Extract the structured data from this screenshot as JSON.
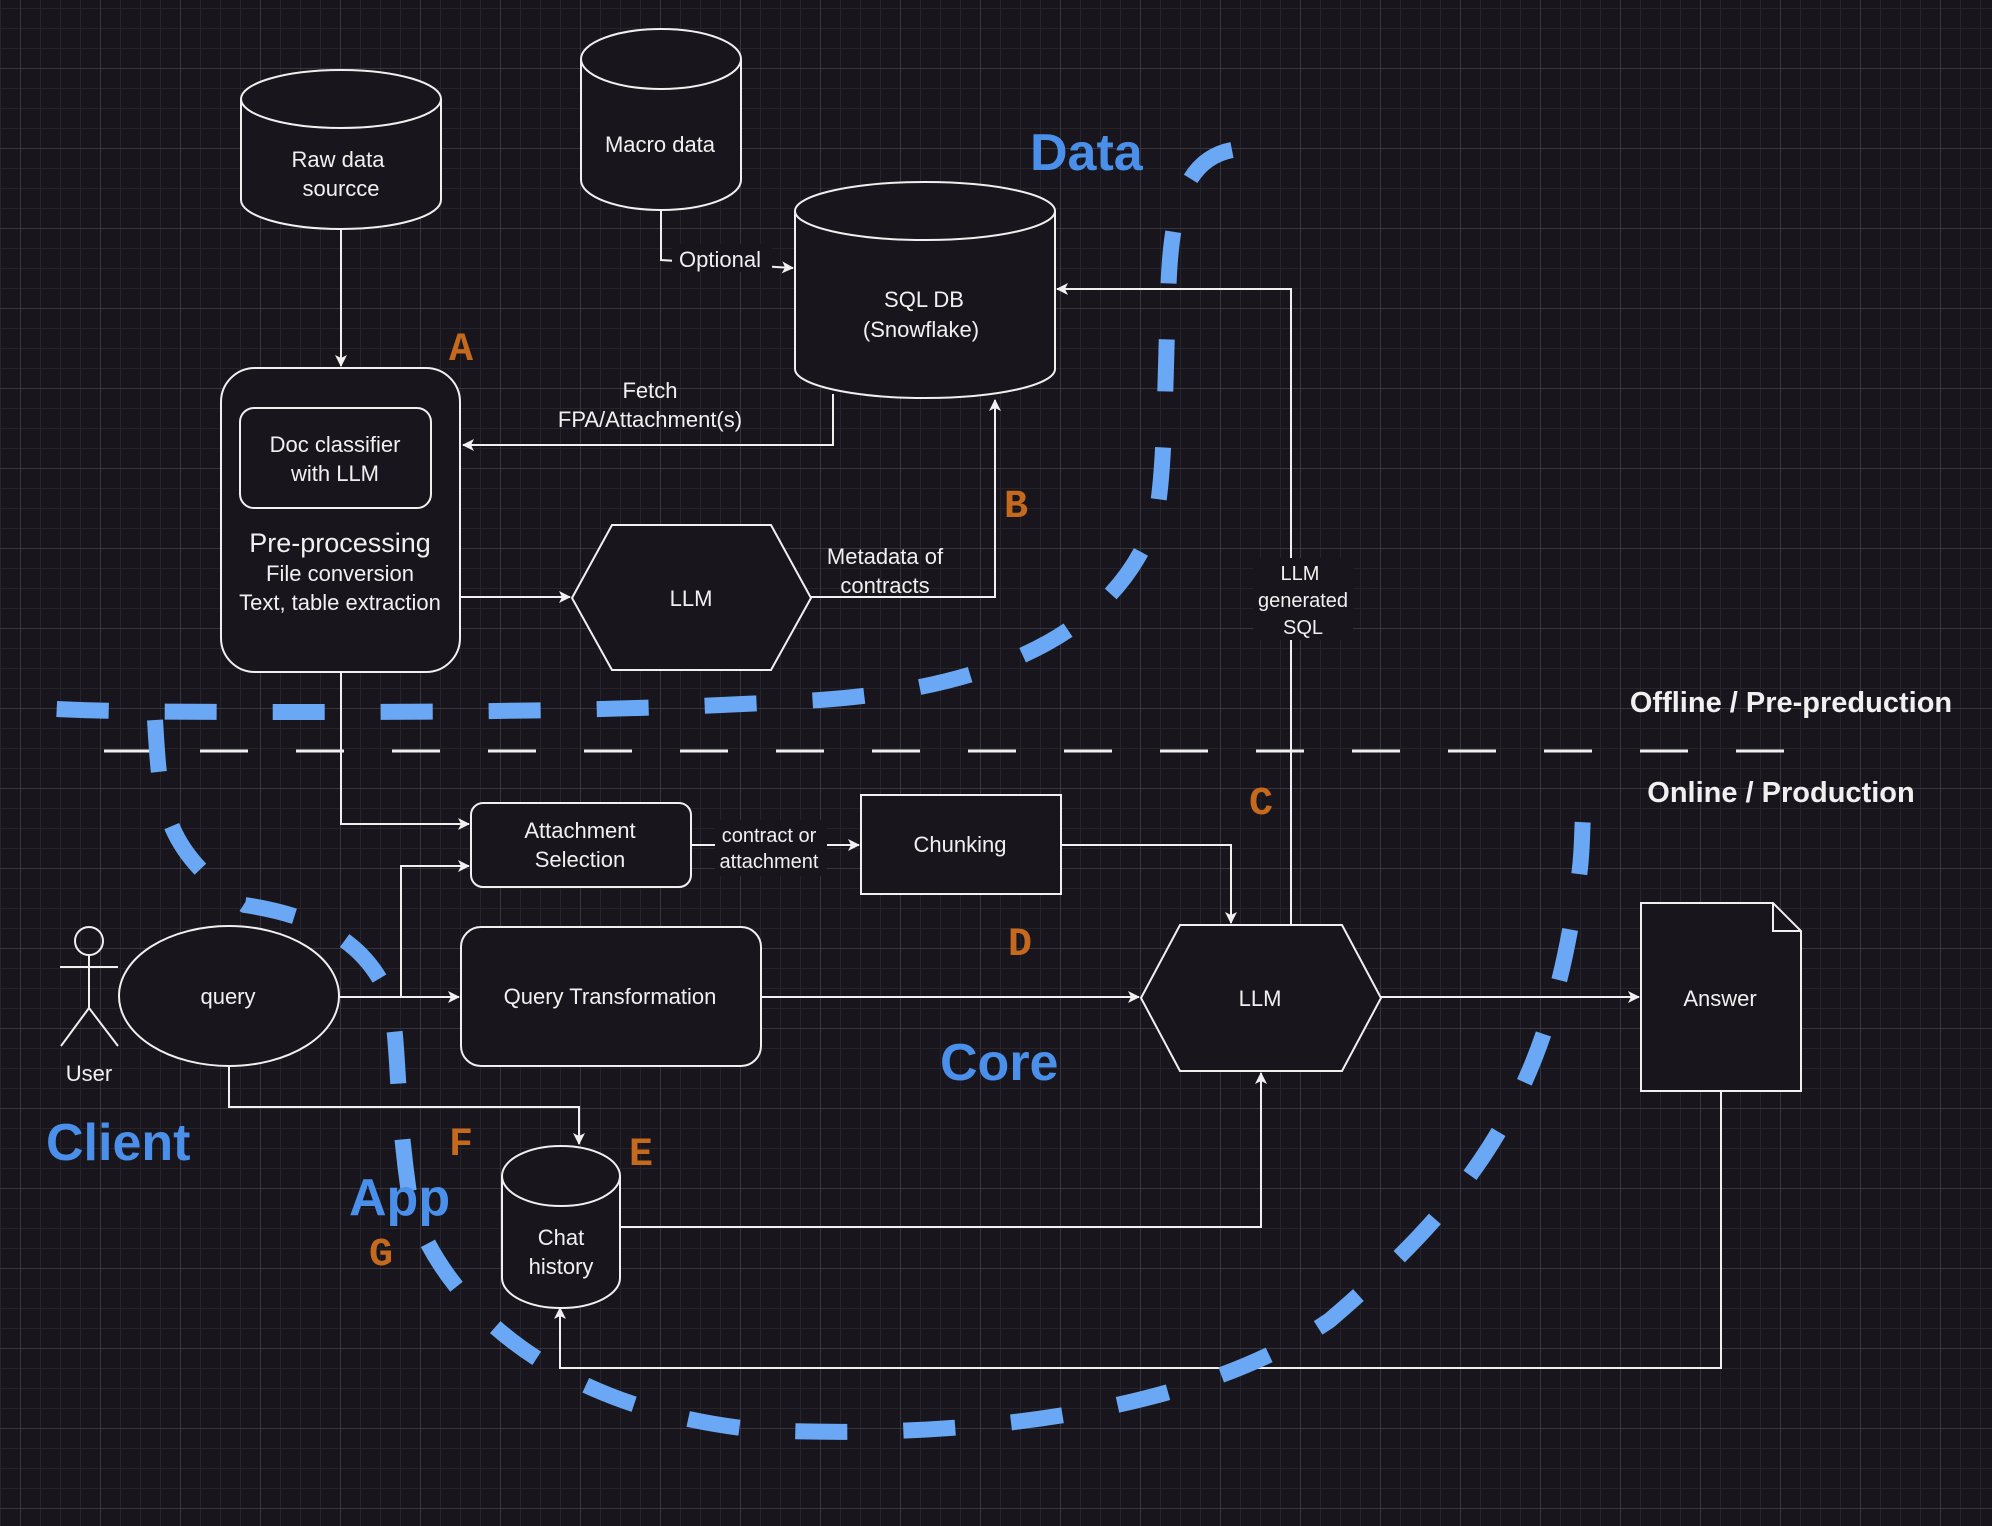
{
  "colors": {
    "background": "#18161c",
    "stroke": "#f0f0f0",
    "zone_label": "#4a90ea",
    "zone_boundary": "#6aa8f5",
    "step_letter": "#c5691f"
  },
  "phases": {
    "offline": "Offline / Pre-preduction",
    "online": "Online / Production"
  },
  "zones": {
    "data": "Data",
    "core": "Core",
    "client": "Client",
    "app": "App"
  },
  "step_letters": [
    "A",
    "B",
    "C",
    "D",
    "E",
    "F",
    "G"
  ],
  "nodes": {
    "raw_data": [
      "Raw data",
      "sourcce"
    ],
    "macro_data": "Macro data",
    "sql_db": [
      "SQL DB",
      "(Snowflake)"
    ],
    "doc_classifier": [
      "Doc classifier",
      "with LLM"
    ],
    "preprocessing": {
      "title": "Pre-processing",
      "lines": [
        "File conversion",
        "Text, table extraction"
      ]
    },
    "llm_offline": "LLM",
    "attachment_selection": [
      "Attachment",
      "Selection"
    ],
    "chunking": "Chunking",
    "user": "User",
    "query": "query",
    "query_transformation": "Query Transformation",
    "llm_online": "LLM",
    "answer": "Answer",
    "chat_history": [
      "Chat",
      "history"
    ]
  },
  "edge_labels": {
    "optional": "Optional",
    "fetch": [
      "Fetch",
      "FPA/Attachment(s)"
    ],
    "metadata": [
      "Metadata of",
      "contracts"
    ],
    "llm_sql": [
      "LLM",
      "generated",
      "SQL"
    ],
    "contract_or_attachment": [
      "contract or",
      "attachment"
    ]
  }
}
